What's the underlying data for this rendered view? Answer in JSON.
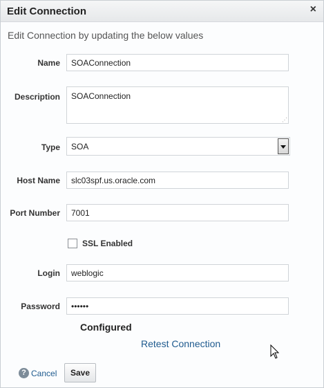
{
  "dialog": {
    "title": "Edit Connection",
    "close_glyph": "×",
    "subtitle": "Edit Connection by updating the below values"
  },
  "form": {
    "name": {
      "label": "Name",
      "value": "SOAConnection"
    },
    "description": {
      "label": "Description",
      "value": "SOAConnection"
    },
    "type": {
      "label": "Type",
      "value": "SOA"
    },
    "host_name": {
      "label": "Host Name",
      "value": "slc03spf.us.oracle.com"
    },
    "port_number": {
      "label": "Port Number",
      "value": "7001"
    },
    "ssl": {
      "label": "SSL Enabled",
      "checked": false
    },
    "login": {
      "label": "Login",
      "value": "weblogic"
    },
    "password": {
      "label": "Password",
      "value": "••••••"
    }
  },
  "status": {
    "configured": "Configured",
    "retest_link": "Retest Connection"
  },
  "footer": {
    "help_glyph": "?",
    "cancel_label": "Cancel",
    "save_label": "Save"
  }
}
